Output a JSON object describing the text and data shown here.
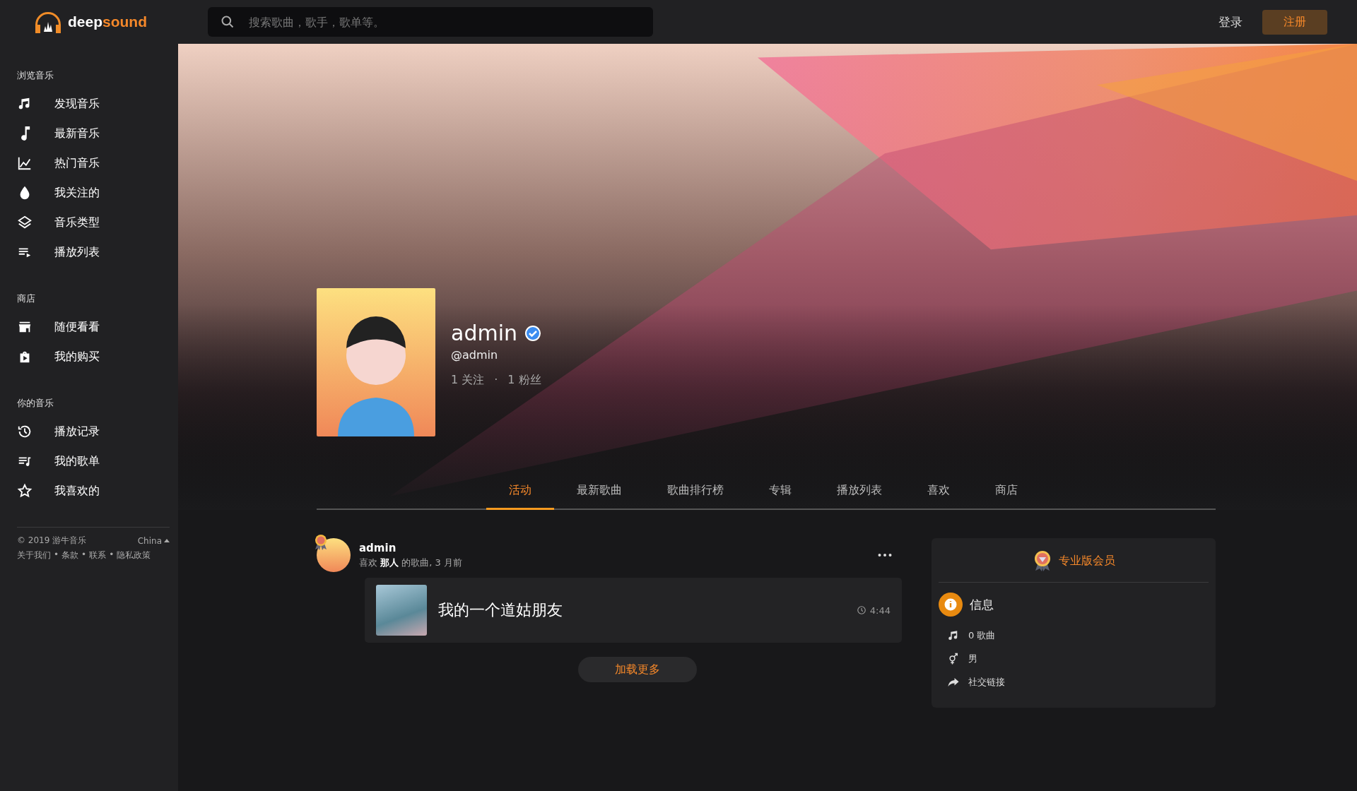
{
  "brand": {
    "name_start": "deep",
    "name_end": "sound"
  },
  "search": {
    "placeholder": "搜索歌曲，歌手，歌单等。"
  },
  "header_actions": {
    "login": "登录",
    "register": "注册"
  },
  "sidebar": {
    "sections": [
      {
        "title": "浏览音乐",
        "items": [
          {
            "label": "发现音乐"
          },
          {
            "label": "最新音乐"
          },
          {
            "label": "热门音乐"
          },
          {
            "label": "我关注的"
          },
          {
            "label": "音乐类型"
          },
          {
            "label": "播放列表"
          }
        ]
      },
      {
        "title": "商店",
        "items": [
          {
            "label": "随便看看"
          },
          {
            "label": "我的购买"
          }
        ]
      },
      {
        "title": "你的音乐",
        "items": [
          {
            "label": "播放记录"
          },
          {
            "label": "我的歌单"
          },
          {
            "label": "我喜欢的"
          }
        ]
      }
    ],
    "footer": {
      "copyright": "© 2019 游牛音乐",
      "language": "China",
      "separator": "•",
      "links": [
        "关于我们",
        "条款",
        "联系",
        "隐私政策"
      ]
    }
  },
  "profile": {
    "name": "admin",
    "verified": true,
    "handle": "@admin",
    "following": "1 关注",
    "stats_separator": "·",
    "followers": "1 粉丝"
  },
  "tabs": [
    {
      "label": "活动",
      "selected": true
    },
    {
      "label": "最新歌曲",
      "selected": false
    },
    {
      "label": "歌曲排行榜",
      "selected": false
    },
    {
      "label": "专辑",
      "selected": false
    },
    {
      "label": "播放列表",
      "selected": false
    },
    {
      "label": "喜欢",
      "selected": false
    },
    {
      "label": "商店",
      "selected": false
    }
  ],
  "activity": [
    {
      "user": "admin",
      "action": "喜欢 **那人** 的歌曲, 3 月前",
      "song_title": "我的一个道姑朋友",
      "duration": "4:44"
    }
  ],
  "load_more": "加载更多",
  "info_card": {
    "membership": "专业版会员",
    "section_title": "信息",
    "rows": [
      "0 歌曲",
      "男",
      "社交链接"
    ]
  }
}
